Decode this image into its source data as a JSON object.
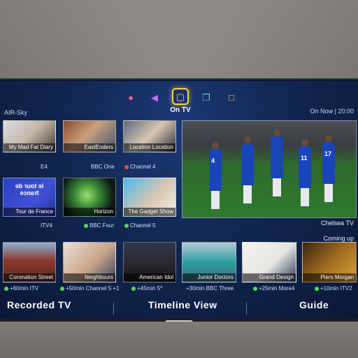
{
  "top_nav": {
    "active_tab_label": "On TV",
    "icons": [
      "camera-icon",
      "play-icon",
      "tv-icon",
      "apps-icon",
      "chat-icon"
    ]
  },
  "header": {
    "source": "AIR-Sky",
    "now_text": "On Now | 20:00"
  },
  "main_tile": {
    "caption": "Chelsea TV",
    "coming_up": "Coming up"
  },
  "on_now": [
    {
      "title": "My Mad Fat Diary",
      "channel": "E4",
      "dot": ""
    },
    {
      "title": "EastEnders",
      "channel": "BBC One",
      "dot": ""
    },
    {
      "title": "Location Location",
      "channel": "Channel 4",
      "dot": "red"
    },
    {
      "title": "Tour de France",
      "channel": "ITV4",
      "dot": ""
    },
    {
      "title": "Horizon",
      "channel": "BBC Four",
      "dot": "green"
    },
    {
      "title": "The Gadget Show",
      "channel": "Channel 5",
      "dot": "green"
    }
  ],
  "tile_art": {
    "tour_logo": "le tour de france"
  },
  "upcoming": [
    {
      "title": "Coronation Street",
      "meta": "+60min ITV",
      "dot": "green"
    },
    {
      "title": "Neighbours",
      "meta": "+50min Channel 5 +1",
      "dot": "green"
    },
    {
      "title": "American Idol",
      "meta": "+45min 5*",
      "dot": "green"
    },
    {
      "title": "Junior Doctors",
      "meta": "+30min BBC Three",
      "dot": ""
    },
    {
      "title": "Grand Design",
      "meta": "+25min More4",
      "dot": "green"
    },
    {
      "title": "Piers Morgan",
      "meta": "+10min ITV2",
      "dot": "green"
    }
  ],
  "bottom_nav": {
    "recorded": "Recorded TV",
    "timeline": "Timeline View",
    "guide": "Guide"
  },
  "colors": {
    "accent": "#ffd23a",
    "screen_bg": "#112650",
    "dot_green": "#4fdc53",
    "dot_red": "#ff4b3a"
  }
}
